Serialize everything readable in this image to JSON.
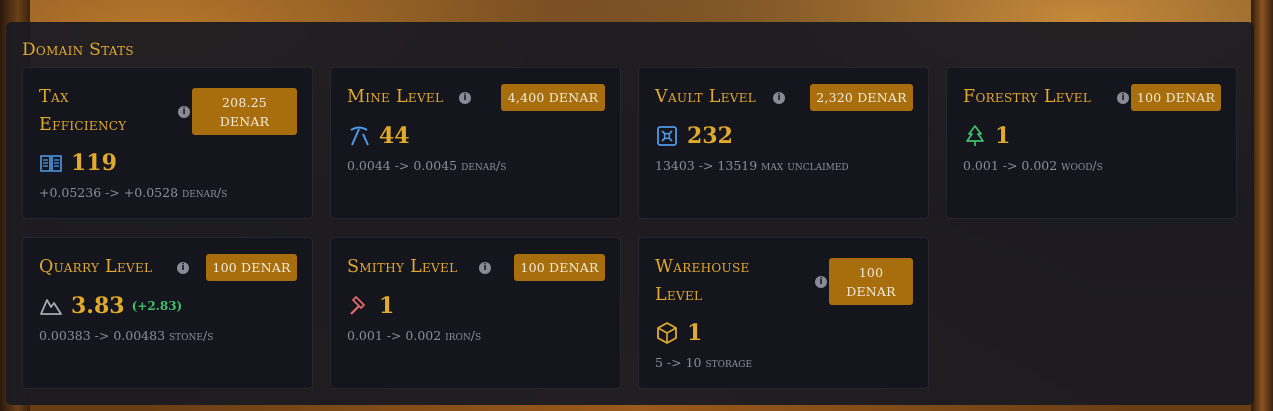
{
  "panel": {
    "title": "Domain Stats"
  },
  "cards": [
    {
      "title": "Tax Efficiency",
      "cost": "208.25 DENAR",
      "icon": "book-icon",
      "value": "119",
      "rate": "+0.05236 -> +0.0528 denar/s"
    },
    {
      "title": "Mine Level",
      "cost": "4,400 DENAR",
      "icon": "pickaxe-icon",
      "value": "44",
      "rate": "0.0044 -> 0.0045 denar/s"
    },
    {
      "title": "Vault Level",
      "cost": "2,320 DENAR",
      "icon": "vault-icon",
      "value": "232",
      "rate": "13403 -> 13519 max unclaimed"
    },
    {
      "title": "Forestry Level",
      "cost": "100 DENAR",
      "icon": "tree-icon",
      "value": "1",
      "rate": "0.001 -> 0.002 wood/s"
    },
    {
      "title": "Quarry Level",
      "cost": "100 DENAR",
      "icon": "mountain-icon",
      "value": "3.83",
      "delta": "(+2.83)",
      "rate": "0.00383 -> 0.00483 stone/s"
    },
    {
      "title": "Smithy Level",
      "cost": "100 DENAR",
      "icon": "hammer-icon",
      "value": "1",
      "rate": "0.001 -> 0.002 iron/s"
    },
    {
      "title": "Warehouse Level",
      "cost": "100 DENAR",
      "icon": "box-icon",
      "value": "1",
      "rate": "5 -> 10 storage"
    }
  ],
  "colors": {
    "accent": "#e2aa2b",
    "cost_bg": "#a86e0e",
    "positive": "#3fbf6a"
  }
}
